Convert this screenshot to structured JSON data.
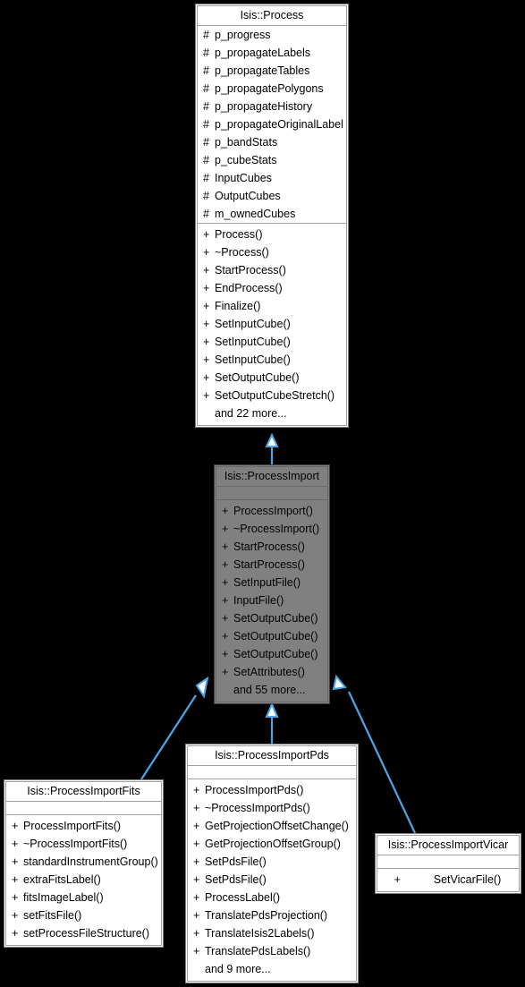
{
  "diagram": {
    "kind": "uml-inheritance-diagram",
    "background_color": "#000000",
    "edge_color": "#4ba6e8",
    "highlight_color": "#808080",
    "box_fill_color": "#ffffff",
    "box_border_color": "#7f7f7f"
  },
  "classes": {
    "process": {
      "name": "Isis::Process",
      "attributes": [
        {
          "visibility": "#",
          "name": "p_progress"
        },
        {
          "visibility": "#",
          "name": "p_propagateLabels"
        },
        {
          "visibility": "#",
          "name": "p_propagateTables"
        },
        {
          "visibility": "#",
          "name": "p_propagatePolygons"
        },
        {
          "visibility": "#",
          "name": "p_propagateHistory"
        },
        {
          "visibility": "#",
          "name": "p_propagateOriginalLabel"
        },
        {
          "visibility": "#",
          "name": "p_bandStats"
        },
        {
          "visibility": "#",
          "name": "p_cubeStats"
        },
        {
          "visibility": "#",
          "name": "InputCubes"
        },
        {
          "visibility": "#",
          "name": "OutputCubes"
        },
        {
          "visibility": "#",
          "name": "m_ownedCubes"
        }
      ],
      "operations": [
        {
          "visibility": "+",
          "name": "Process()"
        },
        {
          "visibility": "+",
          "name": "~Process()"
        },
        {
          "visibility": "+",
          "name": "StartProcess()"
        },
        {
          "visibility": "+",
          "name": "EndProcess()"
        },
        {
          "visibility": "+",
          "name": "Finalize()"
        },
        {
          "visibility": "+",
          "name": "SetInputCube()"
        },
        {
          "visibility": "+",
          "name": "SetInputCube()"
        },
        {
          "visibility": "+",
          "name": "SetInputCube()"
        },
        {
          "visibility": "+",
          "name": "SetOutputCube()"
        },
        {
          "visibility": "+",
          "name": "SetOutputCubeStretch()"
        },
        {
          "visibility": "",
          "name": "and 22 more..."
        }
      ]
    },
    "processimport": {
      "name": "Isis::ProcessImport",
      "highlighted": true,
      "attributes": [],
      "operations": [
        {
          "visibility": "+",
          "name": "ProcessImport()"
        },
        {
          "visibility": "+",
          "name": "~ProcessImport()"
        },
        {
          "visibility": "+",
          "name": "StartProcess()"
        },
        {
          "visibility": "+",
          "name": "StartProcess()"
        },
        {
          "visibility": "+",
          "name": "SetInputFile()"
        },
        {
          "visibility": "+",
          "name": "InputFile()"
        },
        {
          "visibility": "+",
          "name": "SetOutputCube()"
        },
        {
          "visibility": "+",
          "name": "SetOutputCube()"
        },
        {
          "visibility": "+",
          "name": "SetOutputCube()"
        },
        {
          "visibility": "+",
          "name": "SetAttributes()"
        },
        {
          "visibility": "",
          "name": "and 55 more..."
        }
      ]
    },
    "processimportfits": {
      "name": "Isis::ProcessImportFits",
      "attributes": [],
      "operations": [
        {
          "visibility": "+",
          "name": "ProcessImportFits()"
        },
        {
          "visibility": "+",
          "name": "~ProcessImportFits()"
        },
        {
          "visibility": "+",
          "name": "standardInstrumentGroup()"
        },
        {
          "visibility": "+",
          "name": "extraFitsLabel()"
        },
        {
          "visibility": "+",
          "name": "fitsImageLabel()"
        },
        {
          "visibility": "+",
          "name": "setFitsFile()"
        },
        {
          "visibility": "+",
          "name": "setProcessFileStructure()"
        }
      ]
    },
    "processimportpds": {
      "name": "Isis::ProcessImportPds",
      "attributes": [],
      "operations": [
        {
          "visibility": "+",
          "name": "ProcessImportPds()"
        },
        {
          "visibility": "+",
          "name": "~ProcessImportPds()"
        },
        {
          "visibility": "+",
          "name": "GetProjectionOffsetChange()"
        },
        {
          "visibility": "+",
          "name": "GetProjectionOffsetGroup()"
        },
        {
          "visibility": "+",
          "name": "SetPdsFile()"
        },
        {
          "visibility": "+",
          "name": "SetPdsFile()"
        },
        {
          "visibility": "+",
          "name": "ProcessLabel()"
        },
        {
          "visibility": "+",
          "name": "TranslatePdsProjection()"
        },
        {
          "visibility": "+",
          "name": "TranslateIsis2Labels()"
        },
        {
          "visibility": "+",
          "name": "TranslatePdsLabels()"
        },
        {
          "visibility": "",
          "name": "and 9 more..."
        }
      ]
    },
    "processimportvicar": {
      "name": "Isis::ProcessImportVicar",
      "attributes": [],
      "operations": [
        {
          "visibility": "+",
          "name": "SetVicarFile()"
        }
      ]
    }
  },
  "edges": [
    {
      "from": "processimport",
      "to": "process",
      "type": "generalization"
    },
    {
      "from": "processimportfits",
      "to": "processimport",
      "type": "generalization"
    },
    {
      "from": "processimportpds",
      "to": "processimport",
      "type": "generalization"
    },
    {
      "from": "processimportvicar",
      "to": "processimport",
      "type": "generalization"
    }
  ]
}
